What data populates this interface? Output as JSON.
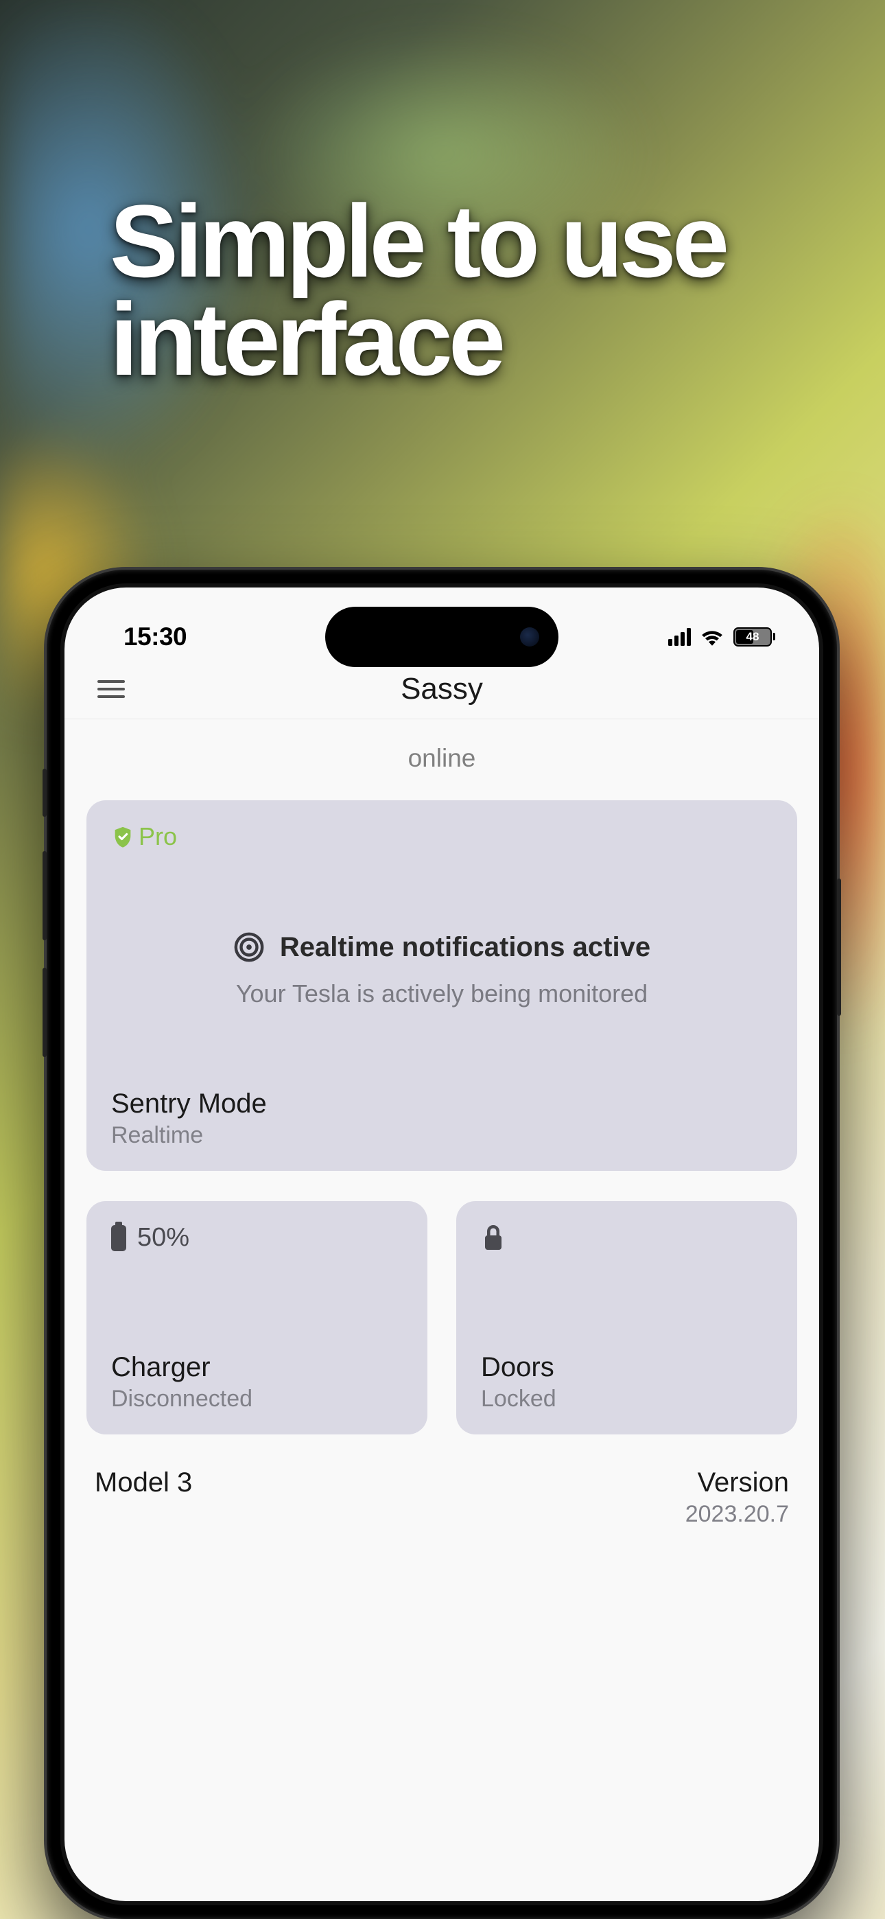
{
  "marketing": {
    "headline": "Simple to use interface"
  },
  "status_bar": {
    "time": "15:30",
    "battery_level": "48"
  },
  "header": {
    "title": "Sassy"
  },
  "connection_status": "online",
  "hero_card": {
    "badge": "Pro",
    "title": "Realtime notifications active",
    "subtitle": "Your Tesla is actively being monitored",
    "footer_title": "Sentry Mode",
    "footer_sub": "Realtime"
  },
  "cards": {
    "charger": {
      "value": "50%",
      "title": "Charger",
      "sub": "Disconnected"
    },
    "doors": {
      "title": "Doors",
      "sub": "Locked"
    }
  },
  "footer": {
    "model": "Model 3",
    "version_label": "Version",
    "version_value": "2023.20.7"
  },
  "colors": {
    "accent_green": "#8bc34a",
    "card_bg": "#dad9e4"
  }
}
